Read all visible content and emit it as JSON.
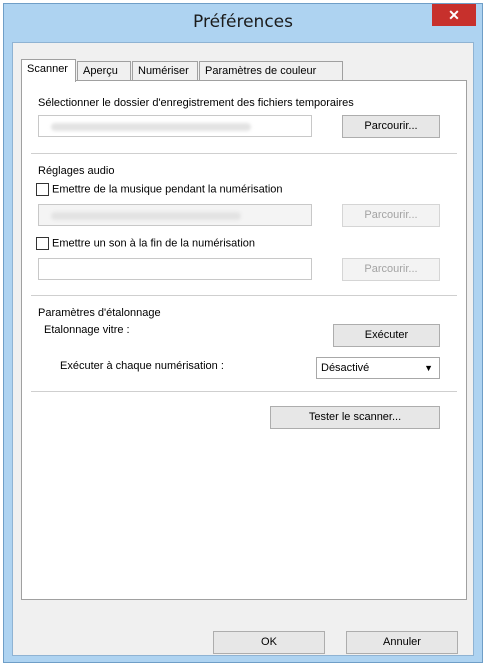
{
  "window": {
    "title": "Préférences",
    "close_glyph": "✕"
  },
  "tabs": [
    {
      "label": "Scanner",
      "active": true
    },
    {
      "label": "Aperçu",
      "active": false
    },
    {
      "label": "Numériser",
      "active": false
    },
    {
      "label": "Paramètres de couleur",
      "active": false
    }
  ],
  "temp_folder": {
    "label": "Sélectionner le dossier d'enregistrement des fichiers temporaires",
    "browse_label": "Parcourir..."
  },
  "audio": {
    "heading": "Réglages audio",
    "music_check_label": "Emettre de la musique pendant la numérisation",
    "music_browse_label": "Parcourir...",
    "sound_check_label": "Emettre un son à la fin de la numérisation",
    "sound_browse_label": "Parcourir..."
  },
  "calibration": {
    "heading": "Paramètres d'étalonnage",
    "platen_label": "Etalonnage vitre :",
    "run_label": "Exécuter",
    "each_scan_label": "Exécuter à chaque numérisation :",
    "each_scan_value": "Désactivé"
  },
  "test_scanner_label": "Tester le scanner...",
  "footer": {
    "ok_label": "OK",
    "cancel_label": "Annuler"
  }
}
